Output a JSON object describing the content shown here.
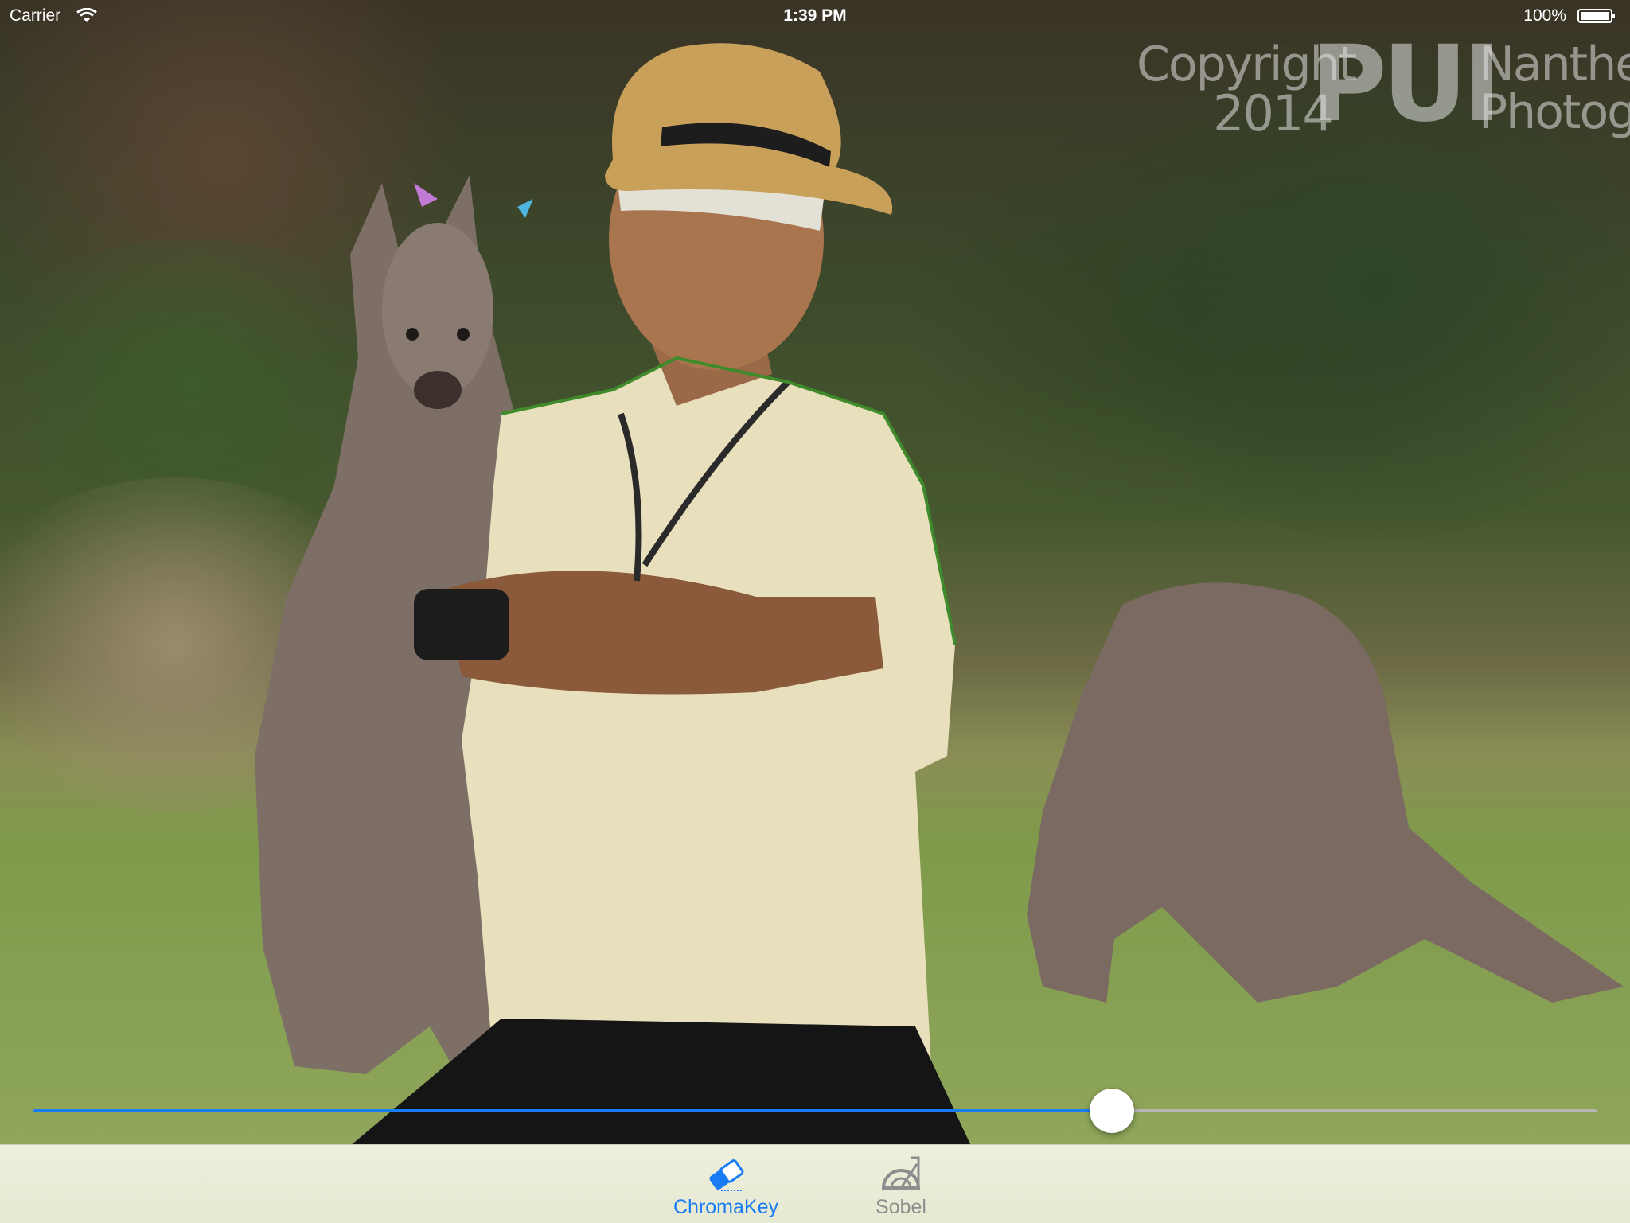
{
  "status_bar": {
    "carrier": "Carrier",
    "time": "1:39 PM",
    "battery": "100%"
  },
  "watermark": {
    "copyright": "Copyright",
    "year": "2014",
    "logo": "PUI",
    "name_line1": "Nanthee",
    "name_line2": "Photograp"
  },
  "slider": {
    "value": 0.69,
    "fill_color": "#1a7cf4"
  },
  "tab_bar": {
    "items": [
      {
        "label": "ChromaKey",
        "icon": "eraser-icon",
        "selected": true
      },
      {
        "label": "Sobel",
        "icon": "protractor-icon",
        "selected": false
      }
    ],
    "selected_color": "#1a7cf4",
    "unselected_color": "#8e8e8e"
  }
}
